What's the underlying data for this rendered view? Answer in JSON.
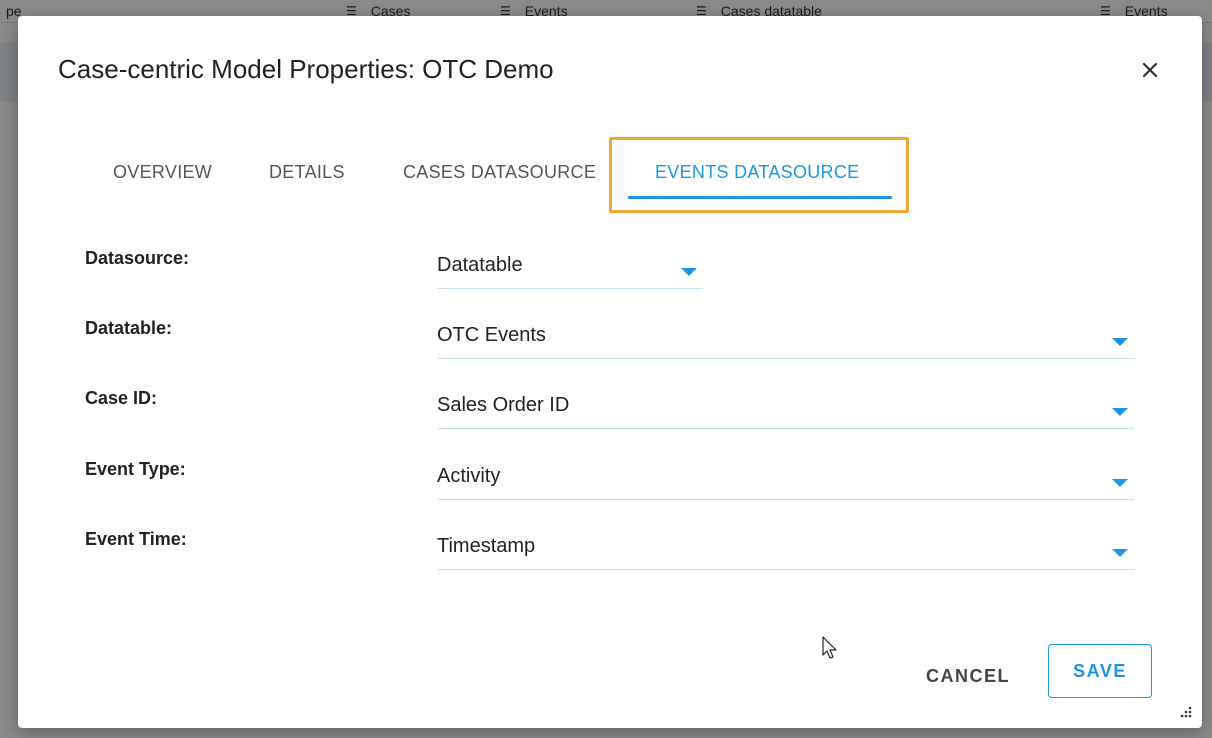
{
  "background": {
    "columns": [
      {
        "label": "pe",
        "filter_icon": "filter-icon"
      },
      {
        "label": "Cases",
        "filter_icon": "filter-icon"
      },
      {
        "label": "Events",
        "filter_icon": "filter-icon"
      },
      {
        "label": "Cases datatable",
        "filter_icon": "filter-icon"
      },
      {
        "label": "Events",
        "filter_icon": "filter-icon"
      }
    ]
  },
  "dialog": {
    "title": "Case-centric Model Properties: OTC Demo",
    "close_icon": "close-icon",
    "tabs": [
      {
        "label": "OVERVIEW",
        "active": false
      },
      {
        "label": "DETAILS",
        "active": false
      },
      {
        "label": "CASES DATASOURCE",
        "active": false
      },
      {
        "label": "EVENTS DATASOURCE",
        "active": true
      }
    ],
    "fields": [
      {
        "label": "Datasource:",
        "value": "Datatable"
      },
      {
        "label": "Datatable:",
        "value": "OTC Events"
      },
      {
        "label": "Case ID:",
        "value": "Sales Order ID"
      },
      {
        "label": "Event Type:",
        "value": "Activity"
      },
      {
        "label": "Event Time:",
        "value": "Timestamp"
      }
    ],
    "buttons": {
      "cancel": "CANCEL",
      "save": "SAVE"
    }
  },
  "colors": {
    "accent": "#1a97e0",
    "highlight": "#f2a934"
  }
}
